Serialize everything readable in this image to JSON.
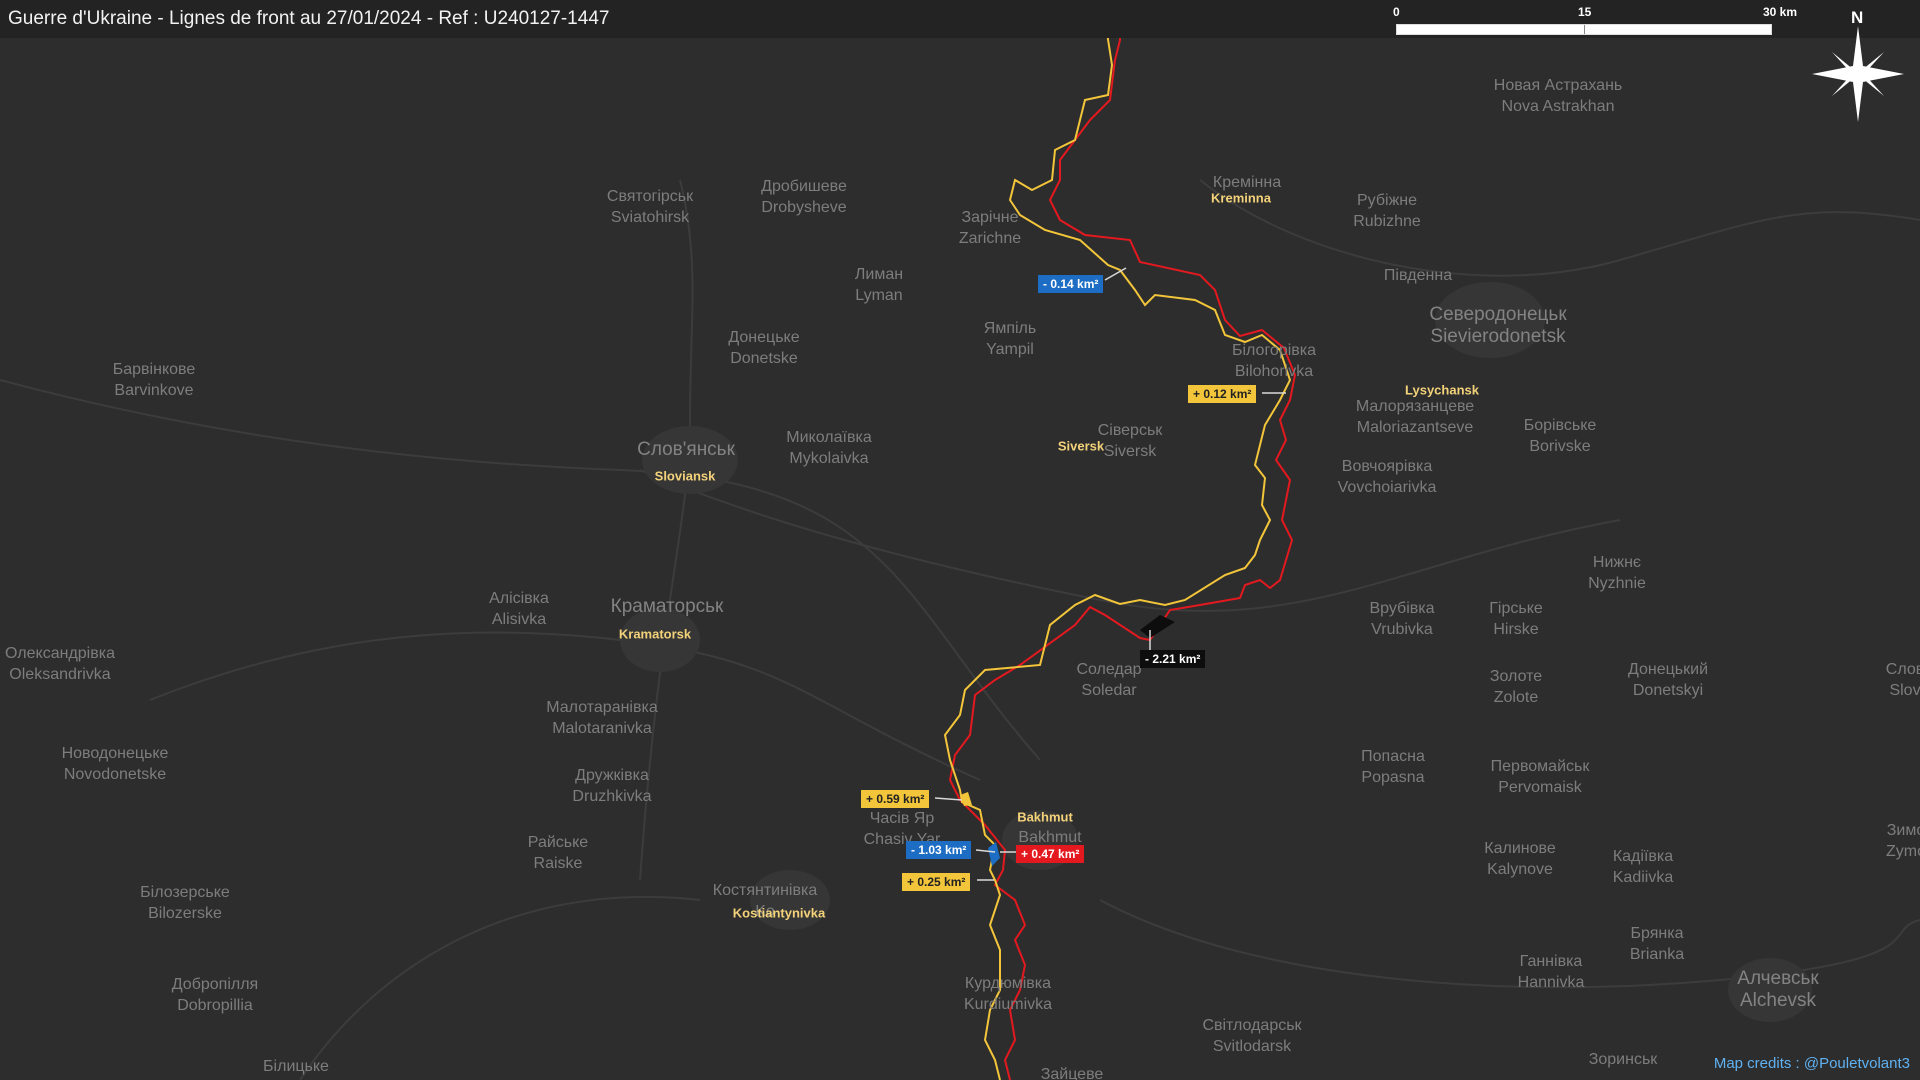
{
  "title": "Guerre d'Ukraine - Lignes de front au 27/01/2024 - Ref : U240127-1447",
  "scale": {
    "tick0": "0",
    "tick1": "15",
    "tick2": "30 km"
  },
  "compass": {
    "label": "N"
  },
  "credits": "Map credits : @Pouletvolant3",
  "colors": {
    "front_yellow": "#f2c53a",
    "front_red": "#e3191f",
    "gain_blue": "#1d6dc4",
    "loss_black": "#0d0d0d"
  },
  "places": [
    {
      "id": "nova-astrakhan",
      "l1": "Новая Астрахань",
      "l2": "Nova Astrakhan"
    },
    {
      "id": "kreminna",
      "l1": "Кремінна",
      "l2": ""
    },
    {
      "id": "rubizhne",
      "l1": "Рубіжне",
      "l2": "Rubizhne"
    },
    {
      "id": "sviatohirsk",
      "l1": "Святогірськ",
      "l2": "Sviatohirsk"
    },
    {
      "id": "drobysheve",
      "l1": "Дробишеве",
      "l2": "Drobysheve"
    },
    {
      "id": "zarichne",
      "l1": "Зарічне",
      "l2": "Zarichne"
    },
    {
      "id": "lyman",
      "l1": "Лиман",
      "l2": "Lyman"
    },
    {
      "id": "pidvenna",
      "l1": "Південна",
      "l2": ""
    },
    {
      "id": "sievierodonetsk",
      "l1": "Северодонецьк",
      "l2": "Sievierodonetsk"
    },
    {
      "id": "donetske",
      "l1": "Донецьке",
      "l2": "Donetske"
    },
    {
      "id": "yampil",
      "l1": "Ямпіль",
      "l2": "Yampil"
    },
    {
      "id": "bilohorivka",
      "l1": "Білогорівка",
      "l2": "Bilohorivka"
    },
    {
      "id": "barvinkove",
      "l1": "Барвінкове",
      "l2": "Barvinkove"
    },
    {
      "id": "maloriazantseve",
      "l1": "Малорязанцеве",
      "l2": "Maloriazantseve"
    },
    {
      "id": "borivske",
      "l1": "Борівське",
      "l2": "Borivske"
    },
    {
      "id": "sloviansk",
      "l1": "Слов'янськ",
      "l2": ""
    },
    {
      "id": "mykolaivka",
      "l1": "Миколаївка",
      "l2": "Mykolaivka"
    },
    {
      "id": "siversk",
      "l1": "Сіверськ",
      "l2": "Siversk"
    },
    {
      "id": "vovchoiarivka",
      "l1": "Вовчоярівка",
      "l2": "Vovchoiarivka"
    },
    {
      "id": "nyzhnie",
      "l1": "Нижнє",
      "l2": "Nyzhnie"
    },
    {
      "id": "alisivka",
      "l1": "Алісівка",
      "l2": "Alisivka"
    },
    {
      "id": "kramatorsk",
      "l1": "Краматорськ",
      "l2": ""
    },
    {
      "id": "vrubivka",
      "l1": "Врубівка",
      "l2": "Vrubivka"
    },
    {
      "id": "hirske",
      "l1": "Гірське",
      "l2": "Hirske"
    },
    {
      "id": "oleksandrivka",
      "l1": "Олександрівка",
      "l2": "Oleksandrivka"
    },
    {
      "id": "soledar",
      "l1": "Соледар",
      "l2": "Soledar"
    },
    {
      "id": "zolote",
      "l1": "Золоте",
      "l2": "Zolote"
    },
    {
      "id": "donetskyi",
      "l1": "Донецький",
      "l2": "Donetskyi"
    },
    {
      "id": "slov-edge",
      "l1": "Слов",
      "l2": "Slov"
    },
    {
      "id": "malotaranivka",
      "l1": "Малотаранівка",
      "l2": "Malotaranivka"
    },
    {
      "id": "novodonetske",
      "l1": "Новодонецьке",
      "l2": "Novodonetske"
    },
    {
      "id": "popasna",
      "l1": "Попасна",
      "l2": "Popasna"
    },
    {
      "id": "druzhkivka",
      "l1": "Дружківка",
      "l2": "Druzhkivka"
    },
    {
      "id": "pervomaisk",
      "l1": "Первомайськ",
      "l2": "Pervomaisk"
    },
    {
      "id": "chasiv-yar",
      "l1": "Часів Яр",
      "l2": "Chasiv Yar"
    },
    {
      "id": "bakhmut",
      "l1": "Bakhmut",
      "l2": ""
    },
    {
      "id": "zymo",
      "l1": "Зимо",
      "l2": "Zymo"
    },
    {
      "id": "raiske",
      "l1": "Райське",
      "l2": "Raiske"
    },
    {
      "id": "kalynove",
      "l1": "Калинове",
      "l2": "Kalynove"
    },
    {
      "id": "kadiivka",
      "l1": "Кадіївка",
      "l2": "Kadiivka"
    },
    {
      "id": "kostiantynivka",
      "l1": "Костянтинівка",
      "l2": "Ko"
    },
    {
      "id": "bilozerske",
      "l1": "Білозерське",
      "l2": "Bilozerske"
    },
    {
      "id": "brianka",
      "l1": "Брянка",
      "l2": "Brianka"
    },
    {
      "id": "hannivka",
      "l1": "Ганнівка",
      "l2": "Hannivka"
    },
    {
      "id": "dobropillia",
      "l1": "Добропілля",
      "l2": "Dobropillia"
    },
    {
      "id": "kurdiumivka",
      "l1": "Курдюмівка",
      "l2": "Kurdiumivka"
    },
    {
      "id": "alchevsk",
      "l1": "Алчевськ",
      "l2": "Alchevsk"
    },
    {
      "id": "svitlodarsk",
      "l1": "Світлодарськ",
      "l2": "Svitlodarsk"
    },
    {
      "id": "bilytske",
      "l1": "Білицьке",
      "l2": ""
    },
    {
      "id": "zorynsk",
      "l1": "Зоринськ",
      "l2": ""
    },
    {
      "id": "zaitseve",
      "l1": "Зайцеве",
      "l2": ""
    }
  ],
  "cities": [
    {
      "id": "kreminna",
      "name": "Kreminna"
    },
    {
      "id": "lysychansk",
      "name": "Lysychansk"
    },
    {
      "id": "sloviansk",
      "name": "Sloviansk"
    },
    {
      "id": "siversk",
      "name": "Siversk"
    },
    {
      "id": "kramatorsk",
      "name": "Kramatorsk"
    },
    {
      "id": "bakhmut",
      "name": "Bakhmut"
    },
    {
      "id": "kostiantynivka",
      "name": "Kostiantynivka"
    }
  ],
  "changes": [
    {
      "id": "zarichne-loss",
      "text": "- 0.14 km²",
      "kind": "blue"
    },
    {
      "id": "bilohorivka-gain",
      "text": "+ 0.12 km²",
      "kind": "yellow"
    },
    {
      "id": "soledar-loss",
      "text": "- 2.21 km²",
      "kind": "black"
    },
    {
      "id": "chasiv-yar-gain",
      "text": "+ 0.59 km²",
      "kind": "yellow"
    },
    {
      "id": "bakhmut-loss",
      "text": "- 1.03 km²",
      "kind": "blue"
    },
    {
      "id": "bakhmut-red-gain",
      "text": "+ 0.47 km²",
      "kind": "red"
    },
    {
      "id": "south-gain",
      "text": "+ 0.25 km²",
      "kind": "yellow"
    }
  ]
}
